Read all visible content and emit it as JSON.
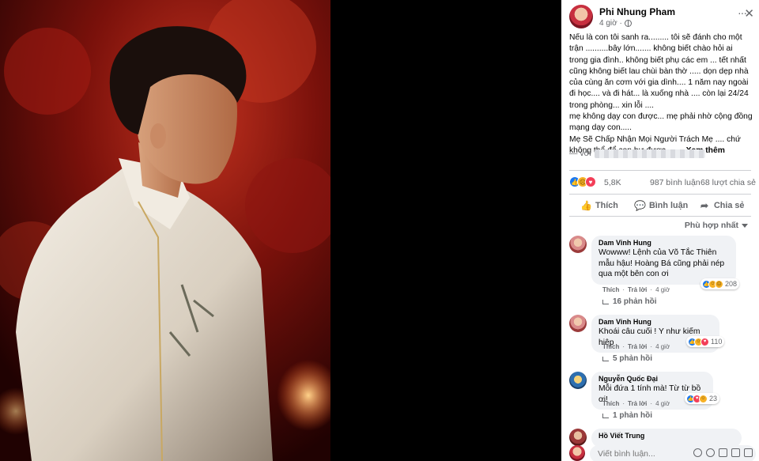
{
  "post": {
    "author": "Phi Nhung Pham",
    "time": "4 giờ ·",
    "more": "···",
    "close": "✕",
    "paragraphs": [
      "Nếu là con tôi sanh ra......... tôi sẽ đánh cho một trận ..........bây lớn....... không biết chào hỏi ai trong gia đình.. không biết phụ các em ... tết nhất cũng không biết lau chùi bàn thờ ..... dọn dẹp nhà của cùng ăn cơm với gia dình.... 1 năm nay ngoài đi học.... và đi hát... là xuống nhà .... còn lại 24/24 trong phòng... xin lỗi ....",
      "mẹ không dạy con được... mẹ phải nhờ cộng đồng mạng dạy con.....",
      "Mẹ Sẽ Chấp Nhận Mọi Người Trách Mẹ .... chứ không thể để con hư được........"
    ],
    "see_more": "Xem thêm",
    "with_prefix": "— với"
  },
  "stats": {
    "reaction_count": "5,8K",
    "comments": "987 bình luận",
    "shares": "68 lượt chia sẻ"
  },
  "actions": {
    "like": "Thích",
    "comment": "Bình luận",
    "share": "Chia sẻ"
  },
  "sort": "Phù hợp nhất",
  "comments": [
    {
      "name": "Dam Vinh Hung",
      "text": "Wowww! Lệnh của Võ Tắc Thiên mẫu hậu! Hoàng Bá cũng phải nép qua một bên con ơi",
      "reactions": "208",
      "like": "Thích",
      "reply": "Trả lời",
      "time": "4 giờ",
      "replies": "16 phản hồi"
    },
    {
      "name": "Dam Vinh Hung",
      "text": "Khoái câu cuối ! Y như kiếm hiệp",
      "reactions": "110",
      "like": "Thích",
      "reply": "Trả lời",
      "time": "4 giờ",
      "replies": "5 phản hồi"
    },
    {
      "name": "Nguyễn Quốc Đại",
      "text": "Mỗi đứa 1 tính mà! Từ từ bồ ơi!",
      "reactions": "23",
      "like": "Thích",
      "reply": "Trả lời",
      "time": "4 giờ",
      "replies": "1 phản hồi"
    },
    {
      "name": "Hồ Viết Trung"
    }
  ],
  "composer": {
    "placeholder": "Viết bình luận..."
  },
  "colors": {
    "accent": "#1877f2",
    "secondary_text": "#65676b",
    "bubble": "#f0f2f5"
  }
}
